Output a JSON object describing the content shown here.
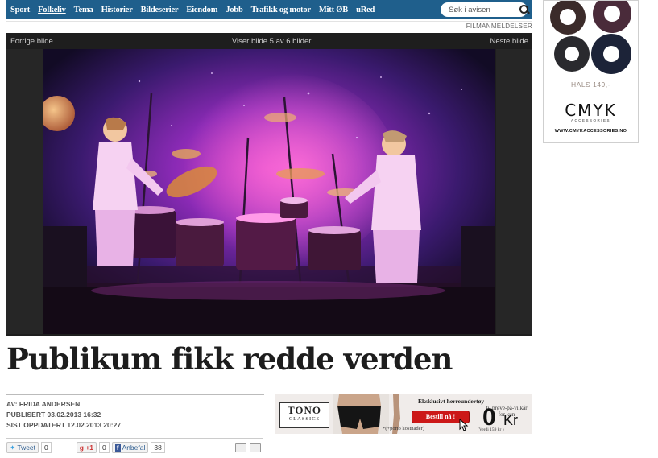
{
  "nav": {
    "items": [
      "Sport",
      "Folkeliv",
      "Tema",
      "Historier",
      "Bildeserier",
      "Eiendom",
      "Jobb",
      "Trafikk og motor",
      "Mitt ØB",
      "uRed"
    ],
    "active_index": 1,
    "search_placeholder": "Søk i avisen",
    "color": "#1f5f8c"
  },
  "section_label": "FILMANMELDELSER",
  "gallery": {
    "prev": "Forrige bilde",
    "counter": "Viser bilde 5 av 6 bilder",
    "next": "Neste bilde"
  },
  "article": {
    "headline": "Publikum fikk redde verden",
    "author": "AV: FRIDA ANDERSEN",
    "published": "PUBLISERT 03.02.2013 16:32",
    "updated": "SIST OPPDATERT 12.02.2013 20:27"
  },
  "social": {
    "tweet_label": "Tweet",
    "tweet_count": "0",
    "gplus_label": "+1",
    "gplus_count": "0",
    "fb_label": "Anbefal",
    "fb_count": "38"
  },
  "banner_ad": {
    "brand": "TONO",
    "brand_sub": "CLASSICS",
    "headline": "Eksklusivt herreundertøy",
    "offer": "til prøve-på-vilkår for kun",
    "button": "Bestill nå !",
    "price": "0",
    "currency": "Kr",
    "note": "(Verdi 159 kr )",
    "shipping": "*(+porto kostnader)"
  },
  "side_ad": {
    "price": "HALS 149,-",
    "brand": "CMYK",
    "brand_sub": "ACCESSORIES",
    "url": "WWW.CMYKACCESSORIES.NO"
  }
}
